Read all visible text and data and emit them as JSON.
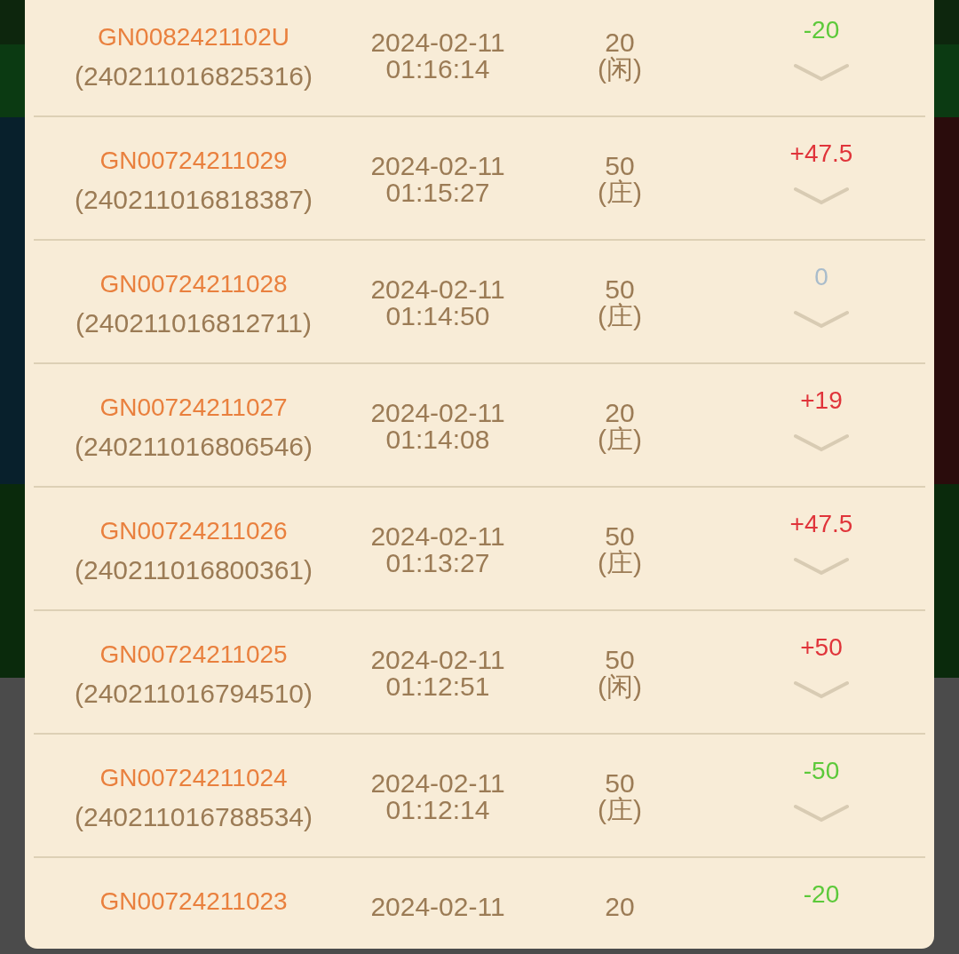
{
  "records": [
    {
      "game_id": "GN0082421102U",
      "order_no": "(240211016825316)",
      "date": "2024-02-11",
      "time": "01:16:14",
      "amount": "20",
      "side": "(闲)",
      "result": "-20",
      "color": "#5cc93a"
    },
    {
      "game_id": "GN00724211029",
      "order_no": "(240211016818387)",
      "date": "2024-02-11",
      "time": "01:15:27",
      "amount": "50",
      "side": "(庄)",
      "result": "+47.5",
      "color": "#e0343a"
    },
    {
      "game_id": "GN00724211028",
      "order_no": "(240211016812711)",
      "date": "2024-02-11",
      "time": "01:14:50",
      "amount": "50",
      "side": "(庄)",
      "result": "0",
      "color": "#a9bccb"
    },
    {
      "game_id": "GN00724211027",
      "order_no": "(240211016806546)",
      "date": "2024-02-11",
      "time": "01:14:08",
      "amount": "20",
      "side": "(庄)",
      "result": "+19",
      "color": "#e0343a"
    },
    {
      "game_id": "GN00724211026",
      "order_no": "(240211016800361)",
      "date": "2024-02-11",
      "time": "01:13:27",
      "amount": "50",
      "side": "(庄)",
      "result": "+47.5",
      "color": "#e0343a"
    },
    {
      "game_id": "GN00724211025",
      "order_no": "(240211016794510)",
      "date": "2024-02-11",
      "time": "01:12:51",
      "amount": "50",
      "side": "(闲)",
      "result": "+50",
      "color": "#e0343a"
    },
    {
      "game_id": "GN00724211024",
      "order_no": "(240211016788534)",
      "date": "2024-02-11",
      "time": "01:12:14",
      "amount": "50",
      "side": "(庄)",
      "result": "-50",
      "color": "#5cc93a"
    },
    {
      "game_id": "GN00724211023",
      "date": "2024-02-11",
      "amount": "20",
      "result": "-20",
      "color": "#5cc93a"
    }
  ]
}
